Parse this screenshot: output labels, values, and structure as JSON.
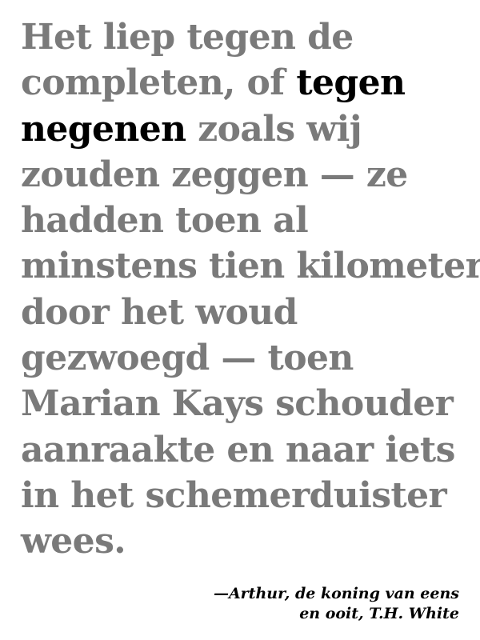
{
  "quote": {
    "line1": "Het liep tegen de",
    "line2_pre": "completen, of ",
    "line2_emph": "tegen",
    "line3_emph": "negenen",
    "line3_post": " zoals wij",
    "line4": "zouden zeggen — ze",
    "line5": "hadden toen al",
    "line6": "minstens tien kilometer",
    "line7": "door het woud",
    "line8": "gezwoegd — toen",
    "line9": "Marian Kays schouder",
    "line10": "aanraakte en naar iets",
    "line11": "in het schemerduister",
    "line12": "wees."
  },
  "attribution": {
    "line1": "—Arthur, de koning van eens",
    "line2": "en ooit, T.H. White"
  },
  "colors": {
    "body_text": "#7a7a7a",
    "emphasis_text": "#000000",
    "background": "#ffffff"
  }
}
